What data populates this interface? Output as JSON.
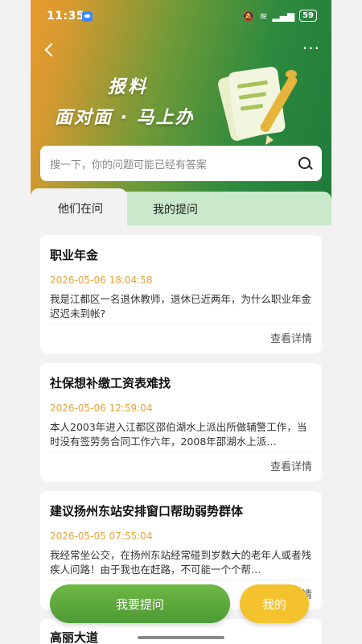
{
  "status_bar": {
    "time": "11:35",
    "battery": "59"
  },
  "hero": {
    "title_line1": "报料",
    "title_line2": "面对面 · 马上办"
  },
  "search": {
    "placeholder": "搜一下，你的问题可能已经有答案"
  },
  "tabs": [
    {
      "label": "他们在问",
      "active": true
    },
    {
      "label": "我的提问",
      "active": false
    }
  ],
  "cards": [
    {
      "title": "职业年金",
      "time": "2026-05-06 18:04:58",
      "content": "我是江都区一名退休教师，退休已近两年，为什么职业年金迟迟未到帐?",
      "detail": "查看详情"
    },
    {
      "title": "社保想补缴工资表难找",
      "time": "2026-05-06 12:59:04",
      "content": "本人2003年进入江都区邵伯湖水上派出所做辅警工作，当时没有签劳务合同工作六年，2008年邵湖水上派…",
      "detail": "查看详情"
    },
    {
      "title": "建议扬州东站安排窗口帮助弱势群体",
      "time": "2026-05-05 07:55:04",
      "content": "我经常坐公交，在扬州东站经常碰到岁数大的老年人或者残疾人问路！由于我也在赶路，不可能一个个帮…",
      "detail": "查看详情"
    },
    {
      "title": "高丽大道"
    }
  ],
  "actions": {
    "ask": "我要提问",
    "mine": "我的"
  },
  "colors": {
    "accent_green": "#4c9a34",
    "accent_yellow": "#f4c22c",
    "time_orange": "#e8a23a"
  }
}
